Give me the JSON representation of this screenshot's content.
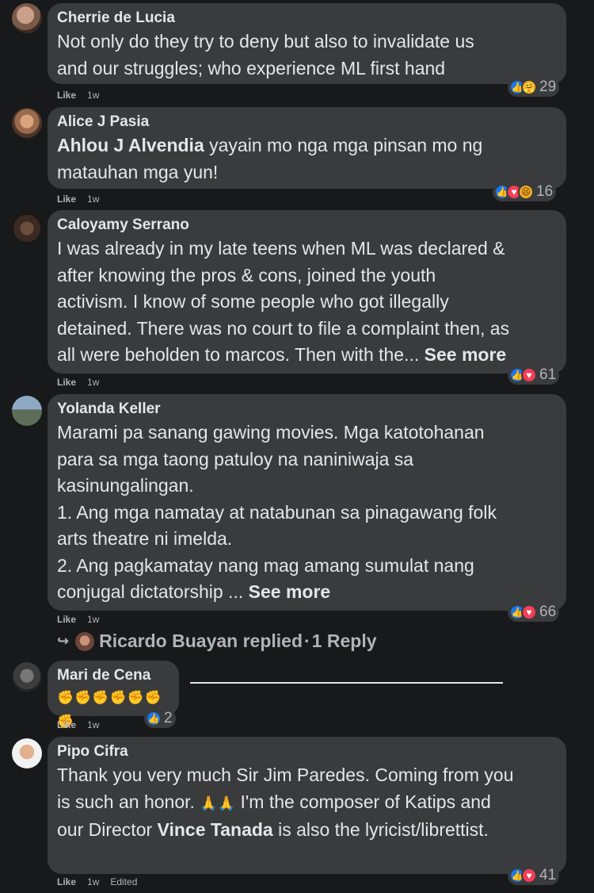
{
  "comments": [
    {
      "author": "Cherrie de Lucia",
      "text": "Not only do they try to deny but also to invalidate us\nand our struggles; who experience ML first hand",
      "like_label": "Like",
      "time": "1w",
      "reaction_count": "29",
      "reactions": [
        "like-icon",
        "care-icon"
      ]
    },
    {
      "author": "Alice J Pasia",
      "mention": "Ahlou J Alvendia",
      "text_after": " yayain mo nga mga pinsan mo ng\nmatauhan mga yun!",
      "like_label": "Like",
      "time": "1w",
      "reaction_count": "16",
      "reactions": [
        "like-icon",
        "love-icon",
        "haha-icon"
      ]
    },
    {
      "author": "Caloyamy Serrano",
      "text": "I was already in my late teens when ML was declared &\nafter knowing the pros & cons, joined the youth\nactivism. I know of some people who got illegally\ndetained. There was no court to file a complaint then, as\nall were beholden to marcos. Then with the... ",
      "see_more": "See more",
      "like_label": "Like",
      "time": "1w",
      "reaction_count": "61",
      "reactions": [
        "like-icon",
        "love-icon"
      ]
    },
    {
      "author": "Yolanda Keller",
      "text": "Marami pa sanang gawing movies. Mga katotohanan\npara sa mga taong patuloy na naniniwaja sa\nkasinungalingan.\n1. Ang mga namatay at natabunan sa pinagawang folk\narts theatre ni imelda.\n2. Ang pagkamatay nang mag amang sumulat nang\nconjugal dictatorship ... ",
      "see_more": "See more",
      "like_label": "Like",
      "time": "1w",
      "reaction_count": "66",
      "reactions": [
        "like-icon",
        "love-icon"
      ],
      "replies": {
        "name": "Ricardo Buayan replied",
        "separator": "·",
        "count_label": "1 Reply"
      }
    },
    {
      "author": "Mari de Cena",
      "text": "✊✊✊✊✊✊✊",
      "like_label": "Like",
      "time": "1w",
      "reaction_count": "2",
      "reactions": [
        "like-icon"
      ]
    },
    {
      "author": "Pipo Cifra",
      "text_part1": "Thank you very much Sir Jim Paredes. Coming from you\nis such an honor. ",
      "pray": "🙏🙏",
      "text_part2": " I'm the composer of Katips and\nour Director ",
      "mention": "Vince Tanada",
      "text_part3": " is also the lyricist/librettist.",
      "like_label": "Like",
      "time": "1w",
      "edited_label": "Edited",
      "reaction_count": "41",
      "reactions": [
        "like-icon",
        "love-icon"
      ]
    }
  ],
  "colors": {
    "background": "#18191a",
    "bubble": "#3a3b3c",
    "text": "#e4e6eb",
    "secondary": "#b0b3b8",
    "like_blue": "#1877f2",
    "love_red": "#f33e58"
  }
}
